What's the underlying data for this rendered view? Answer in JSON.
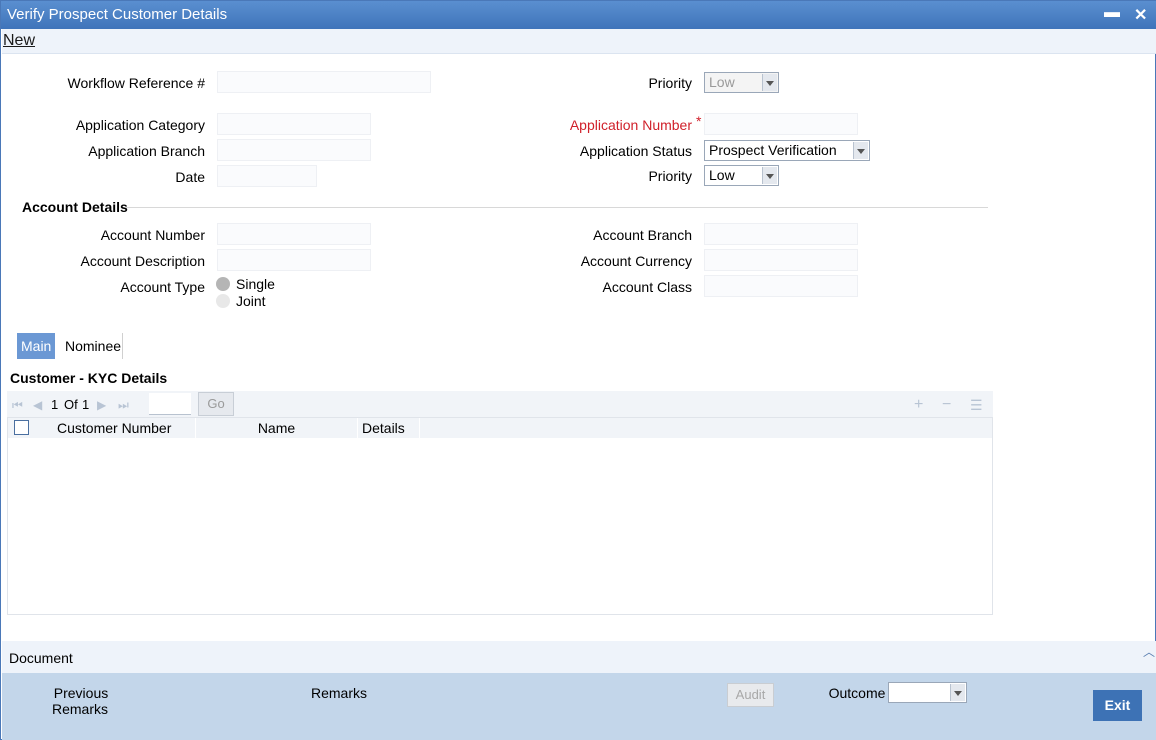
{
  "window": {
    "title": "Verify Prospect Customer Details"
  },
  "menu": {
    "new_label": "New"
  },
  "header": {
    "workflow_ref_label": "Workflow Reference #",
    "priority_label": "Priority",
    "priority_value": "Low",
    "app_category_label": "Application Category",
    "app_branch_label": "Application Branch",
    "date_label": "Date",
    "app_number_label": "Application Number",
    "required_mark": "*",
    "app_status_label": "Application Status",
    "app_status_value": "Prospect Verification",
    "priority2_label": "Priority",
    "priority2_value": "Low"
  },
  "account": {
    "section_title": "Account Details",
    "number_label": "Account Number",
    "description_label": "Account Description",
    "type_label": "Account Type",
    "type_options": [
      "Single",
      "Joint"
    ],
    "branch_label": "Account Branch",
    "currency_label": "Account Currency",
    "class_label": "Account Class"
  },
  "tabs": [
    "Main",
    "Nominee"
  ],
  "kyc": {
    "section_title": "Customer - KYC Details",
    "page_current": "1",
    "page_of": "Of",
    "page_total": "1",
    "go_label": "Go",
    "columns": [
      "Customer Number",
      "Name",
      "Details"
    ]
  },
  "document": {
    "label": "Document"
  },
  "footer": {
    "previous_remarks_line1": "Previous",
    "previous_remarks_line2": "Remarks",
    "remarks_label": "Remarks",
    "audit_label": "Audit",
    "outcome_label": "Outcome",
    "exit_label": "Exit"
  },
  "colors": {
    "titlebar": "#3f74ba",
    "accent": "#6b98d4",
    "required": "#d0202a",
    "footer": "#c3d6ea",
    "exit_button": "#3d72b5"
  }
}
